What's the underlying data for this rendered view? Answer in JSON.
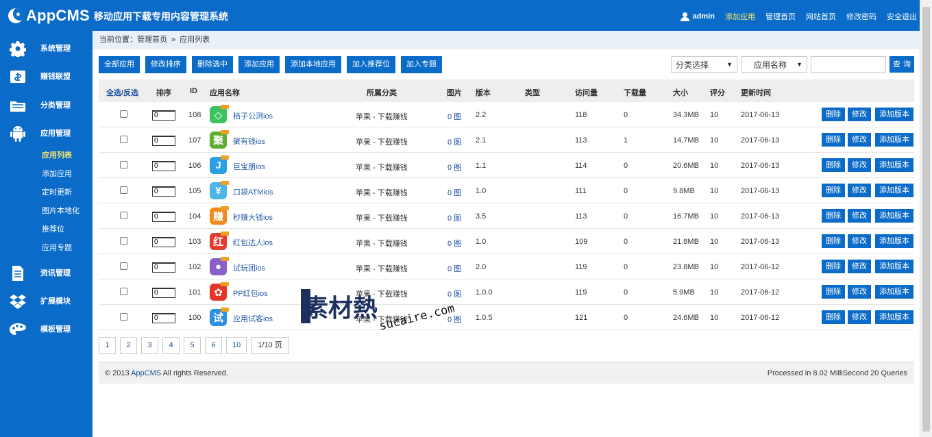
{
  "header": {
    "logo_text": "AppCMS",
    "subtitle": "移动应用下载专用内容管理系统",
    "user": "admin",
    "links": [
      "添加应用",
      "管理首页",
      "网站首页",
      "修改密码",
      "安全退出"
    ]
  },
  "sidebar": {
    "menus": [
      {
        "label": "系统管理",
        "icon": "gear-icon"
      },
      {
        "label": "赚钱联盟",
        "icon": "money-icon"
      },
      {
        "label": "分类管理",
        "icon": "folder-icon"
      },
      {
        "label": "应用管理",
        "icon": "android-icon"
      },
      {
        "label": "资讯管理",
        "icon": "document-icon"
      },
      {
        "label": "扩展模块",
        "icon": "dropbox-icon"
      },
      {
        "label": "模板管理",
        "icon": "palette-icon"
      }
    ],
    "submenu": [
      "应用列表",
      "添加应用",
      "定时更新",
      "图片本地化",
      "推荐位",
      "应用专题"
    ]
  },
  "breadcrumb": {
    "prefix": "当前位置：",
    "home": "管理首页",
    "sep": "»",
    "current": "应用列表"
  },
  "toolbar": [
    "全部应用",
    "修改排序",
    "删除选中",
    "添加应用",
    "添加本地应用",
    "加入推荐位",
    "加入专题"
  ],
  "filters": {
    "category": "分类选择",
    "field": "应用名称",
    "search_btn": "查询"
  },
  "table": {
    "headers": {
      "select": "全选/反选",
      "sort": "排序",
      "id": "ID",
      "name": "应用名称",
      "category": "所属分类",
      "pic": "图片",
      "version": "版本",
      "type": "类型",
      "views": "访问量",
      "downloads": "下载量",
      "size": "大小",
      "score": "评分",
      "date": "更新时间"
    },
    "rows": [
      {
        "sort": "0",
        "id": "108",
        "name": "桔子公测ios",
        "icon_char": "◇",
        "icon_color": "#3ec25e",
        "category": "苹果 - 下载赚钱",
        "pic": "0 图",
        "version": "2.2",
        "views": "118",
        "downloads": "0",
        "size": "34.3MB",
        "score": "10",
        "date": "2017-06-13"
      },
      {
        "sort": "0",
        "id": "107",
        "name": "聚有钱ios",
        "icon_char": "聚",
        "icon_color": "#5fae2e",
        "category": "苹果 - 下载赚钱",
        "pic": "0 图",
        "version": "2.1",
        "views": "113",
        "downloads": "1",
        "size": "14.7MB",
        "score": "10",
        "date": "2017-06-13"
      },
      {
        "sort": "0",
        "id": "106",
        "name": "巨宝朋ios",
        "icon_char": "J",
        "icon_color": "#2b9fe3",
        "category": "苹果 - 下载赚钱",
        "pic": "0 图",
        "version": "1.1",
        "views": "114",
        "downloads": "0",
        "size": "20.6MB",
        "score": "10",
        "date": "2017-06-13"
      },
      {
        "sort": "0",
        "id": "105",
        "name": "口袋ATMios",
        "icon_char": "¥",
        "icon_color": "#4db4e8",
        "category": "苹果 - 下载赚钱",
        "pic": "0 图",
        "version": "1.0",
        "views": "111",
        "downloads": "0",
        "size": "9.8MB",
        "score": "10",
        "date": "2017-06-13"
      },
      {
        "sort": "0",
        "id": "104",
        "name": "秒赚大钱ios",
        "icon_char": "赚",
        "icon_color": "#f18a1c",
        "category": "苹果 - 下载赚钱",
        "pic": "0 图",
        "version": "3.5",
        "views": "113",
        "downloads": "0",
        "size": "16.7MB",
        "score": "10",
        "date": "2017-06-13"
      },
      {
        "sort": "0",
        "id": "103",
        "name": "红包达人ios",
        "icon_char": "红",
        "icon_color": "#e23b2f",
        "category": "苹果 - 下载赚钱",
        "pic": "0 图",
        "version": "1.0",
        "views": "109",
        "downloads": "0",
        "size": "21.8MB",
        "score": "10",
        "date": "2017-06-13"
      },
      {
        "sort": "0",
        "id": "102",
        "name": "试玩团ios",
        "icon_char": "●",
        "icon_color": "#8a5fc9",
        "category": "苹果 - 下载赚钱",
        "pic": "0 图",
        "version": "2.0",
        "views": "119",
        "downloads": "0",
        "size": "23.8MB",
        "score": "10",
        "date": "2017-06-12"
      },
      {
        "sort": "0",
        "id": "101",
        "name": "PP红包ios",
        "icon_char": "✿",
        "icon_color": "#e5342a",
        "category": "苹果 - 下载赚钱",
        "pic": "0 图",
        "version": "1.0.0",
        "views": "119",
        "downloads": "0",
        "size": "5.9MB",
        "score": "10",
        "date": "2017-06-12"
      },
      {
        "sort": "0",
        "id": "100",
        "name": "应用试客ios",
        "icon_char": "试",
        "icon_color": "#2f8fe0",
        "category": "苹果 - 下载赚钱",
        "pic": "0 图",
        "version": "1.0.5",
        "views": "121",
        "downloads": "0",
        "size": "24.6MB",
        "score": "10",
        "date": "2017-06-12"
      }
    ],
    "actions": {
      "delete": "删除",
      "edit": "修改",
      "add_version": "添加版本"
    }
  },
  "pager": {
    "pages": [
      "1",
      "2",
      "3",
      "4",
      "5",
      "6",
      "10"
    ],
    "total": "1/10 页"
  },
  "footer": {
    "copyright_pre": "© 2013 ",
    "brand": "AppCMS",
    "copyright_post": " All rights Reserved.",
    "processed": "Processed in 8.02 MilliSecond 20 Queries"
  },
  "watermark": {
    "text_cn": "素材熱",
    "text_en": "sucaire.com"
  }
}
